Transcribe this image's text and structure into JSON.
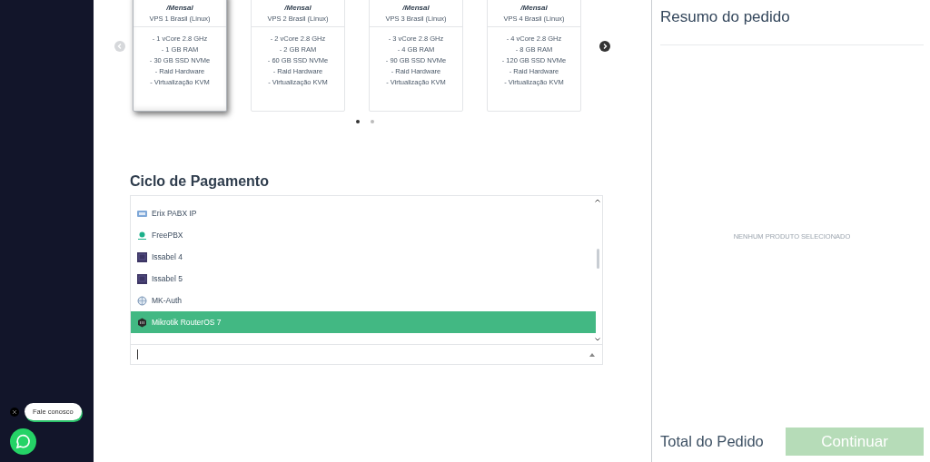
{
  "plans": {
    "prev_disabled": true,
    "next_disabled": false,
    "cards": [
      {
        "period": "/Mensal",
        "name": "VPS 1 Brasil (Linux)",
        "selected": true,
        "features": [
          "- 1 vCore 2.8 GHz",
          "- 1 GB RAM",
          "- 30 GB SSD NVMe",
          "- Raid Hardware",
          "- Virtualização KVM"
        ]
      },
      {
        "period": "/Mensal",
        "name": "VPS 2 Brasil (Linux)",
        "selected": false,
        "features": [
          "- 2 vCore 2.8 GHz",
          "- 2 GB RAM",
          "- 60 GB SSD NVMe",
          "- Raid Hardware",
          "- Virtualização KVM"
        ]
      },
      {
        "period": "/Mensal",
        "name": "VPS 3 Brasil (Linux)",
        "selected": false,
        "features": [
          "- 3 vCore 2.8 GHz",
          "- 4 GB RAM",
          "- 90 GB SSD NVMe",
          "- Raid Hardware",
          "- Virtualização KVM"
        ]
      },
      {
        "period": "/Mensal",
        "name": "VPS 4 Brasil (Linux)",
        "selected": false,
        "features": [
          "- 4 vCore 2.8 GHz",
          "- 8 GB RAM",
          "- 120 GB SSD NVMe",
          "- Raid Hardware",
          "- Virtualização KVM"
        ]
      }
    ],
    "dots": [
      {
        "selected": true
      },
      {
        "selected": false
      }
    ]
  },
  "payment": {
    "title": "Ciclo de Pagamento",
    "options": [
      {
        "label": "Erix PABX IP",
        "kind": "badge",
        "selected": false
      },
      {
        "label": "FreePBX",
        "kind": "leaf",
        "selected": false
      },
      {
        "label": "Issabel 4",
        "kind": "tile",
        "selected": false
      },
      {
        "label": "Issabel 5",
        "kind": "tile",
        "selected": false
      },
      {
        "label": "MK-Auth",
        "kind": "globe",
        "selected": false
      },
      {
        "label": "Mikrotik RouterOS 7",
        "kind": "hexagon",
        "selected": true
      }
    ]
  },
  "summary": {
    "title": "Resumo do pedido",
    "empty": "NENHUM PRODUTO SELECIONADO",
    "total_label": "Total do Pedido",
    "continue_button": {
      "label": "Continuar",
      "disabled": true
    }
  },
  "chat": {
    "label": "Fale conosco"
  }
}
